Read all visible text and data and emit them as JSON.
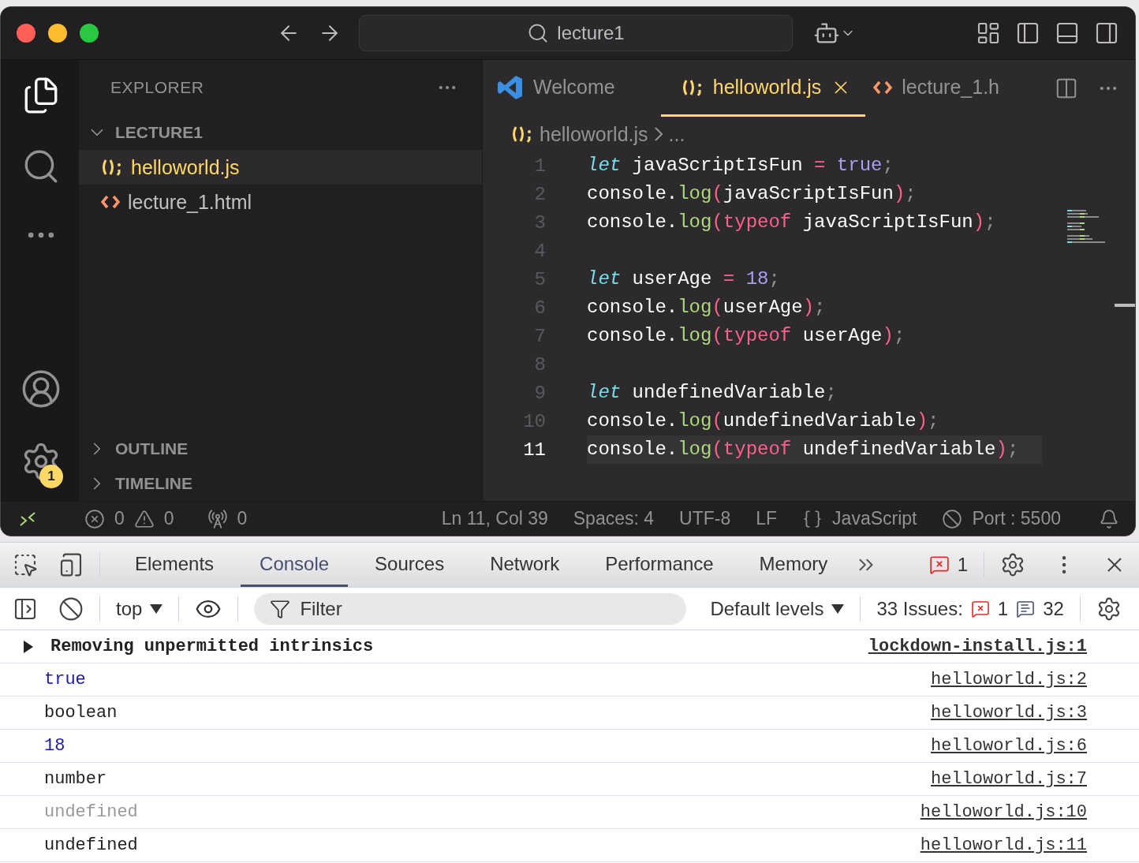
{
  "titlebar": {
    "search": "lecture1"
  },
  "activity_bar": {
    "settings_badge": "1"
  },
  "explorer": {
    "title": "EXPLORER",
    "folder": {
      "name": "LECTURE1",
      "expanded": true
    },
    "files": [
      {
        "name": "helloworld.js",
        "kind": "js",
        "selected": true
      },
      {
        "name": "lecture_1.html",
        "kind": "html",
        "selected": false
      }
    ],
    "sections": [
      {
        "name": "OUTLINE",
        "expanded": false
      },
      {
        "name": "TIMELINE",
        "expanded": false
      }
    ]
  },
  "editor": {
    "tabs": [
      {
        "label": "Welcome",
        "kind": "welcome",
        "selected": false
      },
      {
        "label": "helloworld.js",
        "kind": "js",
        "selected": true
      },
      {
        "label": "lecture_1.h",
        "kind": "html",
        "selected": false
      }
    ],
    "breadcrumb": {
      "file": "helloworld.js",
      "rest": "..."
    },
    "lines": [
      {
        "number": "1",
        "active": false,
        "tokens": [
          {
            "text": "let ",
            "kind": "kw"
          },
          {
            "text": "javaScriptIsFun ",
            "kind": "id"
          },
          {
            "text": "= ",
            "kind": "op"
          },
          {
            "text": "true",
            "kind": "lit"
          },
          {
            "text": ";",
            "kind": "semi"
          }
        ]
      },
      {
        "number": "2",
        "active": false,
        "tokens": [
          {
            "text": "console.",
            "kind": "id"
          },
          {
            "text": "log",
            "kind": "fn"
          },
          {
            "text": "(",
            "kind": "op"
          },
          {
            "text": "javaScriptIsFun",
            "kind": "id"
          },
          {
            "text": ")",
            "kind": "op"
          },
          {
            "text": ";",
            "kind": "semi"
          }
        ]
      },
      {
        "number": "3",
        "active": false,
        "tokens": [
          {
            "text": "console.",
            "kind": "id"
          },
          {
            "text": "log",
            "kind": "fn"
          },
          {
            "text": "(",
            "kind": "op"
          },
          {
            "text": "typeof ",
            "kind": "op"
          },
          {
            "text": "javaScriptIsFun",
            "kind": "id"
          },
          {
            "text": ")",
            "kind": "op"
          },
          {
            "text": ";",
            "kind": "semi"
          }
        ]
      },
      {
        "number": "4",
        "active": false
      },
      {
        "number": "5",
        "active": false,
        "tokens": [
          {
            "text": "let ",
            "kind": "kw"
          },
          {
            "text": "userAge ",
            "kind": "id"
          },
          {
            "text": "= ",
            "kind": "op"
          },
          {
            "text": "18",
            "kind": "lit"
          },
          {
            "text": ";",
            "kind": "semi"
          }
        ]
      },
      {
        "number": "6",
        "active": false,
        "tokens": [
          {
            "text": "console.",
            "kind": "id"
          },
          {
            "text": "log",
            "kind": "fn"
          },
          {
            "text": "(",
            "kind": "op"
          },
          {
            "text": "userAge",
            "kind": "id"
          },
          {
            "text": ")",
            "kind": "op"
          },
          {
            "text": ";",
            "kind": "semi"
          }
        ]
      },
      {
        "number": "7",
        "active": false,
        "tokens": [
          {
            "text": "console.",
            "kind": "id"
          },
          {
            "text": "log",
            "kind": "fn"
          },
          {
            "text": "(",
            "kind": "op"
          },
          {
            "text": "typeof ",
            "kind": "op"
          },
          {
            "text": "userAge",
            "kind": "id"
          },
          {
            "text": ")",
            "kind": "op"
          },
          {
            "text": ";",
            "kind": "semi"
          }
        ]
      },
      {
        "number": "8",
        "active": false
      },
      {
        "number": "9",
        "active": false,
        "tokens": [
          {
            "text": "let ",
            "kind": "kw"
          },
          {
            "text": "undefinedVariable",
            "kind": "id"
          },
          {
            "text": ";",
            "kind": "semi"
          }
        ]
      },
      {
        "number": "10",
        "active": false,
        "tokens": [
          {
            "text": "console.",
            "kind": "id"
          },
          {
            "text": "log",
            "kind": "fn"
          },
          {
            "text": "(",
            "kind": "op"
          },
          {
            "text": "undefinedVariable",
            "kind": "id"
          },
          {
            "text": ")",
            "kind": "op"
          },
          {
            "text": ";",
            "kind": "semi"
          }
        ]
      },
      {
        "number": "11",
        "active": true,
        "tokens": [
          {
            "text": "console.",
            "kind": "id"
          },
          {
            "text": "log",
            "kind": "fn"
          },
          {
            "text": "(",
            "kind": "op"
          },
          {
            "text": "typeof ",
            "kind": "op"
          },
          {
            "text": "undefinedVariable",
            "kind": "id"
          },
          {
            "text": ")",
            "kind": "op"
          },
          {
            "text": ";",
            "kind": "semi"
          }
        ]
      }
    ]
  },
  "status_bar": {
    "errors": "0",
    "warnings": "0",
    "ports": "0",
    "items": [
      "Ln 11, Col 39",
      "Spaces: 4",
      "UTF-8",
      "LF"
    ],
    "language": "JavaScript",
    "port": "Port : 5500"
  },
  "devtools": {
    "tabs": [
      {
        "label": "Elements",
        "selected": false
      },
      {
        "label": "Console",
        "selected": true
      },
      {
        "label": "Sources",
        "selected": false
      },
      {
        "label": "Network",
        "selected": false
      },
      {
        "label": "Performance",
        "selected": false
      },
      {
        "label": "Memory",
        "selected": false
      }
    ],
    "error_count": "1",
    "context": "top",
    "filter_placeholder": "Filter",
    "levels": "Default levels",
    "issues_label": "33 Issues:",
    "issues_errors": "1",
    "issues_info": "32",
    "messages": [
      {
        "text": "Removing unpermitted intrinsics",
        "kind": "group",
        "source": "lockdown-install.js:1"
      },
      {
        "text": "true",
        "kind": "value",
        "source": "helloworld.js:2"
      },
      {
        "text": "boolean",
        "kind": "string",
        "source": "helloworld.js:3"
      },
      {
        "text": "18",
        "kind": "value",
        "source": "helloworld.js:6"
      },
      {
        "text": "number",
        "kind": "string",
        "source": "helloworld.js:7"
      },
      {
        "text": "undefined",
        "kind": "undefined",
        "source": "helloworld.js:10"
      },
      {
        "text": "undefined",
        "kind": "string",
        "source": "helloworld.js:11"
      }
    ]
  }
}
